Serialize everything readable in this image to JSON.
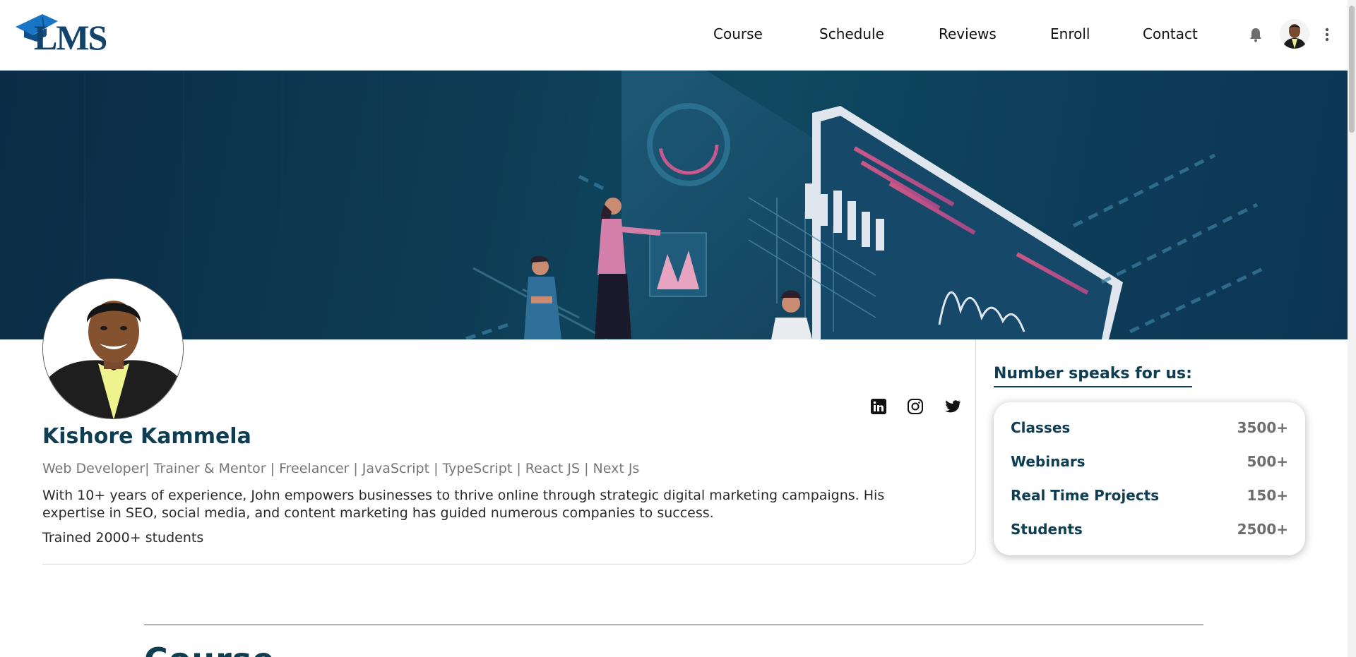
{
  "logo": {
    "text": "LMS"
  },
  "nav": {
    "items": [
      {
        "label": "Course"
      },
      {
        "label": "Schedule"
      },
      {
        "label": "Reviews"
      },
      {
        "label": "Enroll"
      },
      {
        "label": "Contact"
      }
    ]
  },
  "header_icons": {
    "notifications": "bell-icon",
    "user_menu": "avatar",
    "more": "more-vertical-icon"
  },
  "profile": {
    "name": "Kishore Kammela",
    "headline": "Web Developer| Trainer & Mentor | Freelancer | JavaScript | TypeScript | React JS | Next Js",
    "bio": "With 10+ years of experience, John empowers businesses to thrive online through strategic digital marketing campaigns. His expertise in SEO, social media, and content marketing has guided numerous companies to success.",
    "trained": "Trained 2000+ students",
    "social": [
      "linkedin-icon",
      "instagram-icon",
      "twitter-icon"
    ]
  },
  "stats": {
    "title": "Number speaks for us:",
    "rows": [
      {
        "label": "Classes",
        "value": "3500+"
      },
      {
        "label": "Webinars",
        "value": "500+"
      },
      {
        "label": "Real Time Projects",
        "value": "150+"
      },
      {
        "label": "Students",
        "value": "2500+"
      }
    ]
  },
  "section": {
    "title": "Course"
  },
  "colors": {
    "brand": "#0f3d52",
    "logo": "#11436b",
    "banner": "#0e3b55"
  }
}
